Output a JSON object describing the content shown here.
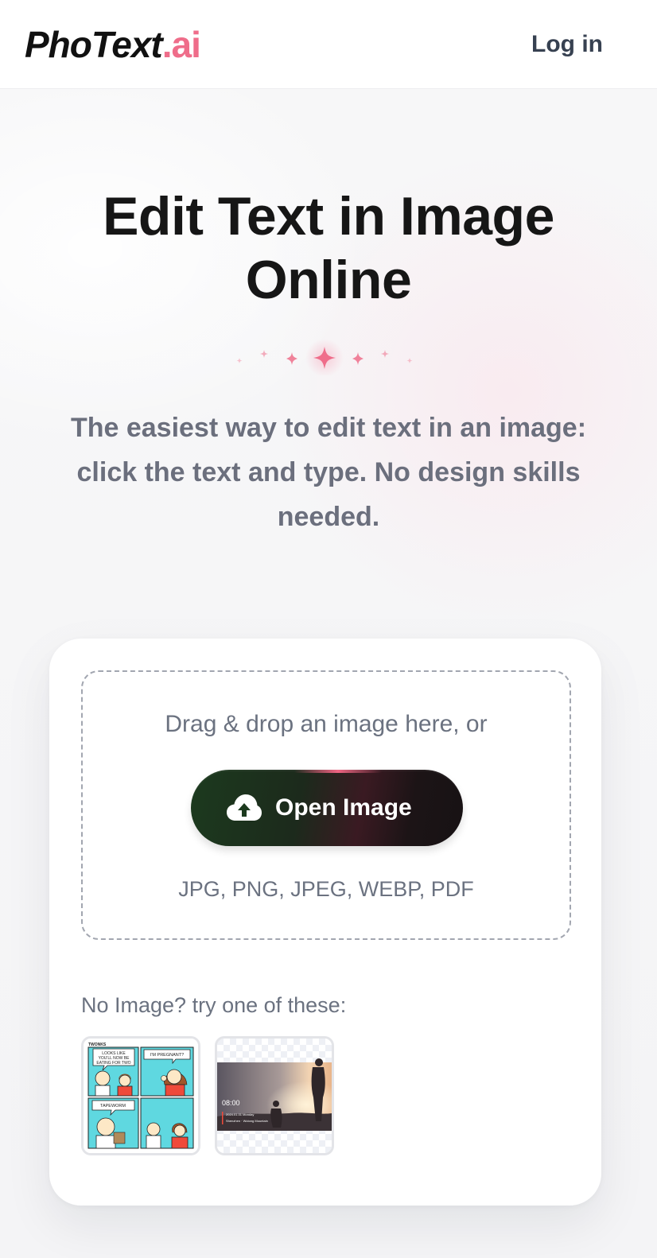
{
  "header": {
    "logo_main": "PhoText",
    "logo_suffix": ".ai",
    "login_label": "Log in"
  },
  "hero": {
    "title": "Edit Text in Image Online",
    "subtitle": "The easiest way to edit text in an image: click the text and type. No design skills needed."
  },
  "upload": {
    "drop_text": "Drag & drop an image here, or",
    "button_label": "Open Image",
    "button_icon": "cloud-upload-icon",
    "formats": "JPG, PNG, JPEG, WEBP, PDF"
  },
  "samples": {
    "prompt": "No Image? try one of these:",
    "comic": {
      "title": "TWONKS",
      "panel1_bubble": "LOOKS LIKE YOU'LL NOW BE EATING FOR TWO",
      "panel2_bubble": "I'M PREGNANT?",
      "panel3_bubble": "TAPEWORM"
    },
    "photo": {
      "time": "08:00",
      "date": "2024.01.01 Monday",
      "location": "Shenzhen · Wutong Mountain"
    }
  },
  "colors": {
    "accent": "#ef6d8a",
    "title": "#161616",
    "muted": "#6b7280"
  }
}
